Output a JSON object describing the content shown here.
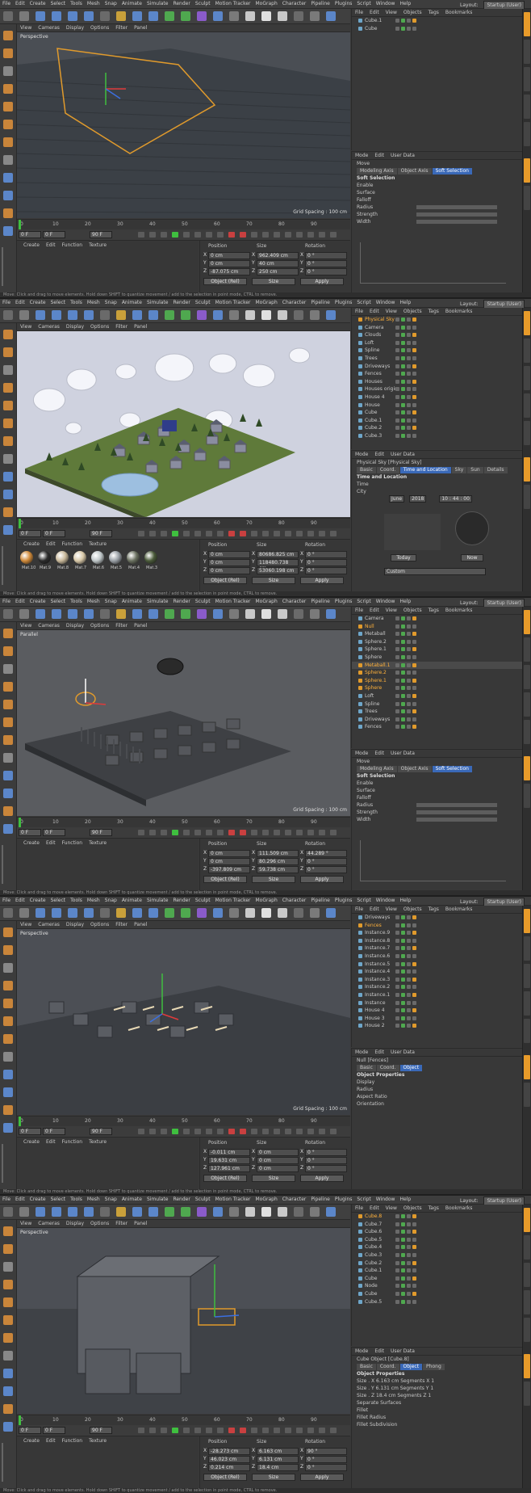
{
  "menu": [
    "File",
    "Edit",
    "Create",
    "Select",
    "Tools",
    "Mesh",
    "Snap",
    "Animate",
    "Simulate",
    "Render",
    "Sculpt",
    "Motion Tracker",
    "MoGraph",
    "Character",
    "Pipeline",
    "Plugins",
    "Script",
    "Window",
    "Help"
  ],
  "layout_label": "Layout:",
  "layout_value": "Startup (User)",
  "viewport_menu": [
    "View",
    "Cameras",
    "Display",
    "Options",
    "Filter",
    "Panel"
  ],
  "obj_menu": [
    "File",
    "Edit",
    "View",
    "Objects",
    "Tags",
    "Bookmarks"
  ],
  "attr_menu": [
    "Mode",
    "Edit",
    "User Data"
  ],
  "mat_menu": [
    "Create",
    "Edit",
    "Function",
    "Texture"
  ],
  "coord_headers": [
    "Position",
    "Size",
    "Rotation"
  ],
  "timeline_ticks": [
    "0",
    "10",
    "20",
    "30",
    "40",
    "50",
    "60",
    "70",
    "80",
    "90"
  ],
  "grid_spacing": "Grid Spacing : 100 cm",
  "apply_label": "Apply",
  "object_rel": "Object (Rel)",
  "size_label": "Size",
  "frame_start": "0 F",
  "frame_end": "90 F",
  "frames": [
    {
      "viewport_label": "Perspective",
      "show_grid_spacing": true,
      "objects": [
        {
          "name": "Cube.1",
          "hl": false,
          "sel": false
        },
        {
          "name": "Cube",
          "hl": false,
          "sel": false
        }
      ],
      "attr": {
        "tool": "Move",
        "tabs": [
          "Modeling Axis",
          "Object Axis",
          "Soft Selection"
        ],
        "active_tab": 2,
        "section": "Soft Selection",
        "rows": [
          "Enable",
          "Surface",
          "Falloff",
          "Radius",
          "Strength",
          "Width"
        ]
      },
      "coords": {
        "x": [
          "0 cm",
          "962.409 cm",
          "0 °"
        ],
        "y": [
          "0 cm",
          "40 cm",
          "0 °"
        ],
        "z": [
          "-87.075 cm",
          "250 cm",
          "0 °"
        ]
      },
      "materials": []
    },
    {
      "viewport_label": "",
      "show_grid_spacing": false,
      "objects": [
        {
          "name": "Physical Sky",
          "hl": true,
          "sel": false
        },
        {
          "name": "Camera",
          "hl": false,
          "sel": false
        },
        {
          "name": "Clouds",
          "hl": false,
          "sel": false
        },
        {
          "name": "Loft",
          "hl": false,
          "sel": false
        },
        {
          "name": "Spline",
          "hl": false,
          "sel": false
        },
        {
          "name": "Trees",
          "hl": false,
          "sel": false
        },
        {
          "name": "Driveways",
          "hl": false,
          "sel": false
        },
        {
          "name": "Fences",
          "hl": false,
          "sel": false
        },
        {
          "name": "Houses",
          "hl": false,
          "sel": false
        },
        {
          "name": "Houses origin",
          "hl": false,
          "sel": false
        },
        {
          "name": "House 4",
          "hl": false,
          "sel": false
        },
        {
          "name": "House",
          "hl": false,
          "sel": false
        },
        {
          "name": "Cube",
          "hl": false,
          "sel": false
        },
        {
          "name": "Cube.1",
          "hl": false,
          "sel": false
        },
        {
          "name": "Cube.2",
          "hl": false,
          "sel": false
        },
        {
          "name": "Cube.3",
          "hl": false,
          "sel": false
        }
      ],
      "attr": {
        "tool": "Physical Sky [Physical Sky]",
        "tabs": [
          "Basic",
          "Coord.",
          "Time and Location",
          "Sky",
          "Sun",
          "Details"
        ],
        "active_tab": 2,
        "section": "Time and Location",
        "rows": [
          "Time",
          "City"
        ],
        "time_month": "June",
        "time_year": "2018",
        "time_clock": "10 : 44 : 00",
        "today": "Today",
        "now": "Now",
        "city": "Custom"
      },
      "coords": {
        "x": [
          "0 cm",
          "80686.825 cm",
          "0 °"
        ],
        "y": [
          "0 cm",
          "118480.738 cm",
          "0 °"
        ],
        "z": [
          "0 cm",
          "53060.198 cm",
          "0 °"
        ]
      },
      "materials": [
        "Mat.10",
        "Mat.9",
        "Mat.8",
        "Mat.7",
        "Mat.6",
        "Mat.5",
        "Mat.4",
        "Mat.3"
      ]
    },
    {
      "viewport_label": "Parallel",
      "show_grid_spacing": true,
      "objects": [
        {
          "name": "Camera",
          "hl": false,
          "sel": false
        },
        {
          "name": "Null",
          "hl": true,
          "sel": false
        },
        {
          "name": "Metaball",
          "hl": false,
          "sel": false
        },
        {
          "name": "Sphere.2",
          "hl": false,
          "sel": false
        },
        {
          "name": "Sphere.1",
          "hl": false,
          "sel": false
        },
        {
          "name": "Sphere",
          "hl": false,
          "sel": false
        },
        {
          "name": "Metaball.1",
          "hl": true,
          "sel": true
        },
        {
          "name": "Sphere.2",
          "hl": true,
          "sel": false
        },
        {
          "name": "Sphere.1",
          "hl": true,
          "sel": false
        },
        {
          "name": "Sphere",
          "hl": true,
          "sel": false
        },
        {
          "name": "Loft",
          "hl": false,
          "sel": false
        },
        {
          "name": "Spline",
          "hl": false,
          "sel": false
        },
        {
          "name": "Trees",
          "hl": false,
          "sel": false
        },
        {
          "name": "Driveways",
          "hl": false,
          "sel": false
        },
        {
          "name": "Fences",
          "hl": false,
          "sel": false
        }
      ],
      "attr": {
        "tool": "Move",
        "tabs": [
          "Modeling Axis",
          "Object Axis",
          "Soft Selection"
        ],
        "active_tab": 2,
        "section": "Soft Selection",
        "rows": [
          "Enable",
          "Surface",
          "Falloff",
          "Radius",
          "Strength",
          "Width"
        ]
      },
      "coords": {
        "x": [
          "0 cm",
          "111.509 cm",
          "44.289 °"
        ],
        "y": [
          "0 cm",
          "80.296 cm",
          "0 °"
        ],
        "z": [
          "-397.809 cm",
          "59.738 cm",
          "0 °"
        ]
      },
      "materials": []
    },
    {
      "viewport_label": "Perspective",
      "show_grid_spacing": true,
      "objects": [
        {
          "name": "Driveways",
          "hl": false,
          "sel": false
        },
        {
          "name": "Fences",
          "hl": true,
          "sel": false
        },
        {
          "name": "Instance.9",
          "hl": false,
          "sel": false
        },
        {
          "name": "Instance.8",
          "hl": false,
          "sel": false
        },
        {
          "name": "Instance.7",
          "hl": false,
          "sel": false
        },
        {
          "name": "Instance.6",
          "hl": false,
          "sel": false
        },
        {
          "name": "Instance.5",
          "hl": false,
          "sel": false
        },
        {
          "name": "Instance.4",
          "hl": false,
          "sel": false
        },
        {
          "name": "Instance.3",
          "hl": false,
          "sel": false
        },
        {
          "name": "Instance.2",
          "hl": false,
          "sel": false
        },
        {
          "name": "Instance.1",
          "hl": false,
          "sel": false
        },
        {
          "name": "Instance",
          "hl": false,
          "sel": false
        },
        {
          "name": "House 4",
          "hl": false,
          "sel": false
        },
        {
          "name": "House 3",
          "hl": false,
          "sel": false
        },
        {
          "name": "House 2",
          "hl": false,
          "sel": false
        }
      ],
      "attr": {
        "tool": "Null [Fences]",
        "tabs": [
          "Basic",
          "Coord.",
          "Object"
        ],
        "active_tab": 2,
        "section": "Object Properties",
        "rows": [
          "Display",
          "Radius",
          "Aspect Ratio",
          "Orientation"
        ]
      },
      "coords": {
        "x": [
          "-0.011 cm",
          "0 cm",
          "0 °"
        ],
        "y": [
          "19.631 cm",
          "0 cm",
          "0 °"
        ],
        "z": [
          "127.961 cm",
          "0 cm",
          "0 °"
        ]
      },
      "materials": []
    },
    {
      "viewport_label": "Perspective",
      "show_grid_spacing": false,
      "objects": [
        {
          "name": "Cube.8",
          "hl": true,
          "sel": false
        },
        {
          "name": "Cube.7",
          "hl": false,
          "sel": false
        },
        {
          "name": "Cube.6",
          "hl": false,
          "sel": false
        },
        {
          "name": "Cube.5",
          "hl": false,
          "sel": false
        },
        {
          "name": "Cube.4",
          "hl": false,
          "sel": false
        },
        {
          "name": "Cube.3",
          "hl": false,
          "sel": false
        },
        {
          "name": "Cube.2",
          "hl": false,
          "sel": false
        },
        {
          "name": "Cube.1",
          "hl": false,
          "sel": false
        },
        {
          "name": "Cube",
          "hl": false,
          "sel": false
        },
        {
          "name": "Node",
          "hl": false,
          "sel": false
        },
        {
          "name": "Cube",
          "hl": false,
          "sel": false
        },
        {
          "name": "Cube.5",
          "hl": false,
          "sel": false
        }
      ],
      "attr": {
        "tool": "Cube Object [Cube.8]",
        "tabs": [
          "Basic",
          "Coord.",
          "Object",
          "Phong"
        ],
        "active_tab": 2,
        "section": "Object Properties",
        "rows": [
          "Size . X   6.163 cm      Segments X  1",
          "Size . Y   6.131 cm      Segments Y  1",
          "Size . Z   18.4 cm        Segments Z  1",
          "Separate Surfaces",
          "Fillet",
          "Fillet Radius",
          "Fillet Subdivision"
        ]
      },
      "coords": {
        "x": [
          "-28.273 cm",
          "6.163 cm",
          "90 °"
        ],
        "y": [
          "46.023 cm",
          "6.131 cm",
          "0 °"
        ],
        "z": [
          "0.214 cm",
          "18.4 cm",
          "0 °"
        ]
      },
      "materials": []
    }
  ],
  "status_text": "Move: Click and drag to move elements. Hold down SHIFT to quantize movement / add to the selection in point mode, CTRL to remove."
}
